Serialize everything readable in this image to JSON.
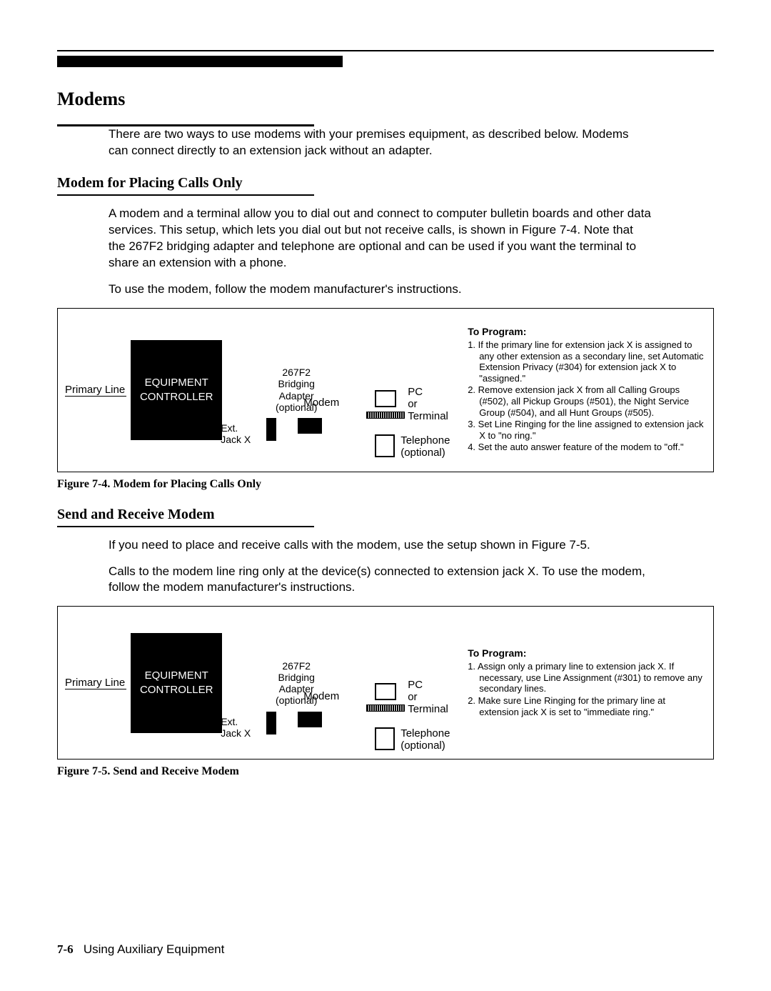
{
  "section_title": "Modems",
  "intro": "There are two ways to use modems with your premises equipment, as described below. Modems can connect directly to an extension jack without an adapter.",
  "sub1_title": "Modem for Placing Calls Only",
  "sub1_p1": "A modem and a terminal allow you to dial out and connect to computer bulletin boards and other data services. This setup, which lets you dial out but not receive calls, is shown in Figure 7-4. Note that the 267F2 bridging adapter and telephone are optional and can be used if you want the terminal to share an extension with a phone.",
  "sub1_p2": "To use the modem, follow the modem manufacturer's instructions.",
  "diagram": {
    "primary_line": "Primary Line",
    "equipment_controller": "EQUIPMENT CONTROLLER",
    "bridging_adapter": "267F2\nBridging\nAdapter\n(optional)",
    "modem": "Modem",
    "ext_jack": "Ext.\nJack X",
    "pc_terminal": "PC\nor\nTerminal",
    "telephone": "Telephone\n(optional)"
  },
  "program1": {
    "heading": "To Program:",
    "items": [
      "1. If the primary line for extension jack X is assigned to any other extension as a secondary line, set Automatic Extension Privacy (#304) for extension jack X to \"assigned.\"",
      "2. Remove extension jack X from all Calling Groups (#502), all Pickup Groups (#501), the Night Service Group (#504), and all Hunt Groups (#505).",
      "3. Set Line Ringing for the line assigned to extension jack X to \"no ring.\"",
      "4. Set the auto answer feature of the modem to \"off.\""
    ]
  },
  "figcaption1": "Figure 7-4. Modem for Placing Calls Only",
  "sub2_title": "Send and Receive Modem",
  "sub2_p1": "If you need to place and receive calls with the modem, use the setup shown in Figure 7-5.",
  "sub2_p2": "Calls to the modem line ring only at the device(s) connected to extension jack X. To use the modem, follow the modem manufacturer's instructions.",
  "program2": {
    "heading": "To Program:",
    "items": [
      "1. Assign only a primary line to extension jack X. If necessary, use Line Assignment (#301) to remove any secondary lines.",
      "2. Make sure Line Ringing for the primary line at extension jack X is set to \"immediate ring.\""
    ]
  },
  "figcaption2": "Figure 7-5. Send and Receive Modem",
  "footer_page": "7-6",
  "footer_text": "Using Auxiliary Equipment"
}
